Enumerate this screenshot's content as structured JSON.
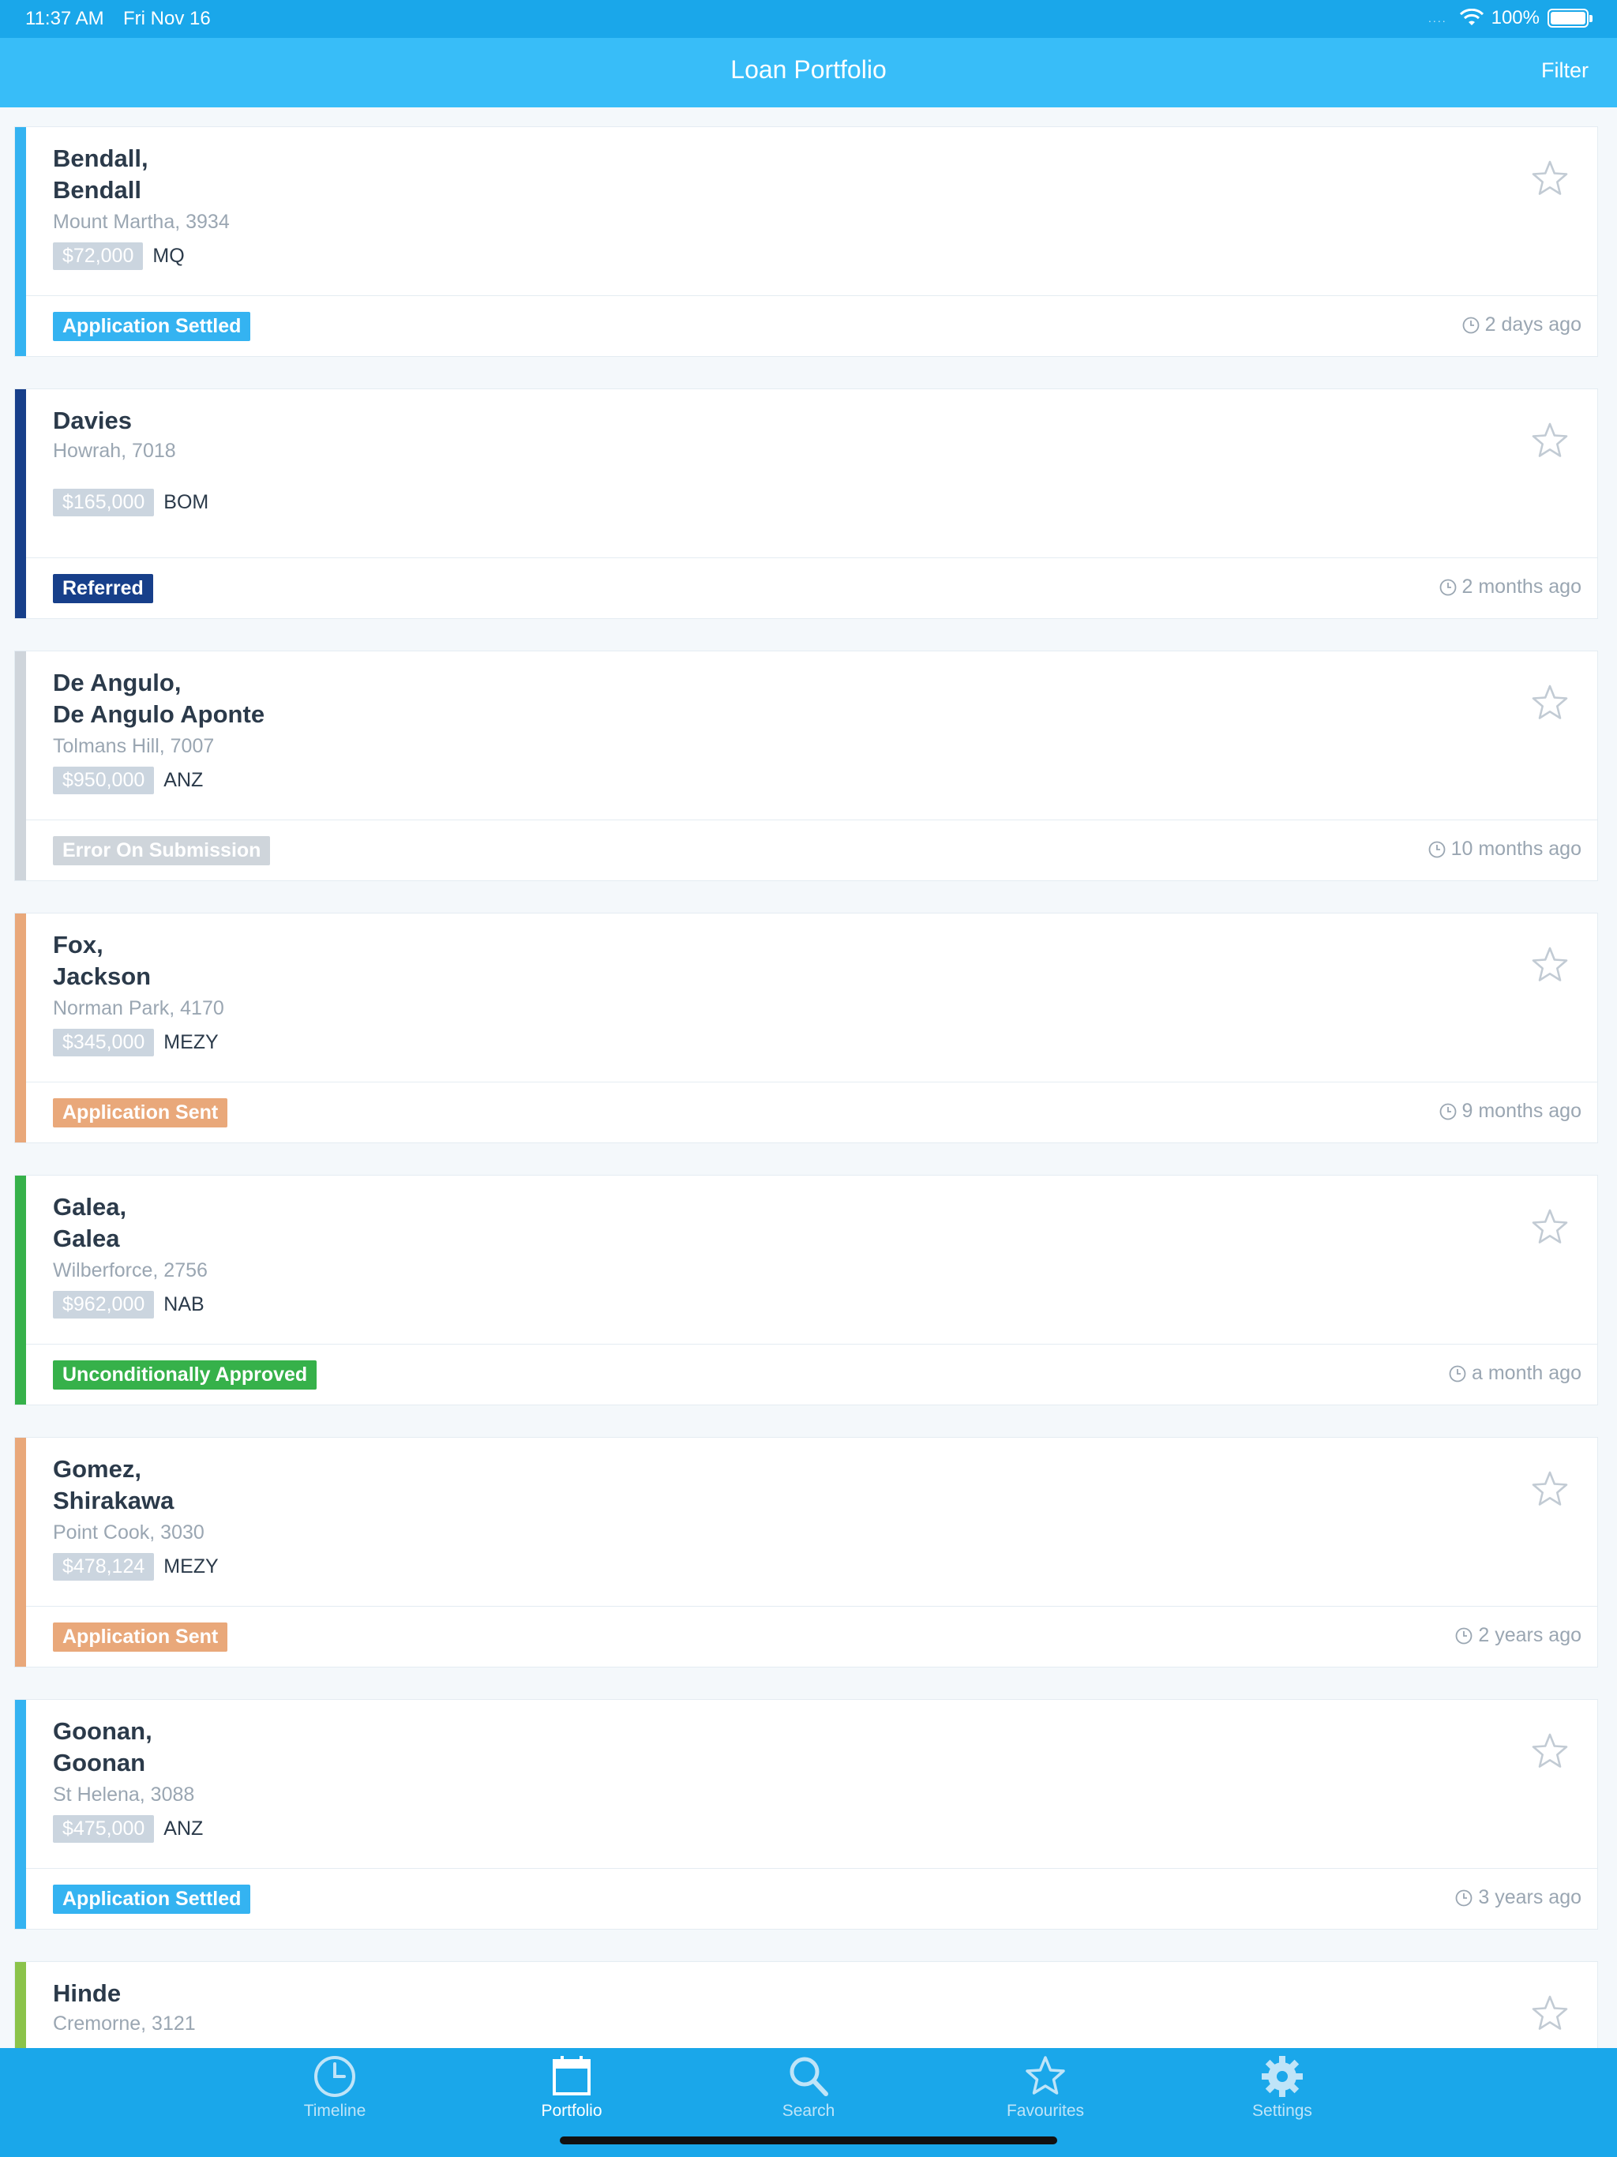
{
  "status_bar": {
    "time": "11:37 AM",
    "date": "Fri Nov 16",
    "signal": "....",
    "battery": "100%"
  },
  "header": {
    "title": "Loan Portfolio",
    "filter_label": "Filter"
  },
  "colors": {
    "settled": "#34b3f1",
    "referred": "#173f8a",
    "error": "#cfd5db",
    "sent": "#e9a87a",
    "approved": "#36b14a",
    "lime": "#8bc34a"
  },
  "loans": [
    {
      "name": "Bendall,\nBendall",
      "location": "Mount Martha, 3934",
      "amount": "$72,000",
      "lender": "MQ",
      "status": "Application Settled",
      "status_color": "#34b3f1",
      "ago": "2 days ago"
    },
    {
      "name": "Davies",
      "location": "Howrah, 7018",
      "amount": "$165,000",
      "lender": "BOM",
      "status": "Referred",
      "status_color": "#173f8a",
      "ago": "2 months ago"
    },
    {
      "name": "De Angulo,\nDe Angulo Aponte",
      "location": "Tolmans Hill, 7007",
      "amount": "$950,000",
      "lender": "ANZ",
      "status": "Error On Submission",
      "status_color": "#cfd5db",
      "ago": "10 months ago"
    },
    {
      "name": "Fox,\nJackson",
      "location": "Norman Park, 4170",
      "amount": "$345,000",
      "lender": "MEZY",
      "status": "Application Sent",
      "status_color": "#e9a87a",
      "ago": "9 months ago"
    },
    {
      "name": "Galea,\nGalea",
      "location": "Wilberforce, 2756",
      "amount": "$962,000",
      "lender": "NAB",
      "status": "Unconditionally Approved",
      "status_color": "#36b14a",
      "ago": "a month ago"
    },
    {
      "name": "Gomez,\nShirakawa",
      "location": "Point Cook, 3030",
      "amount": "$478,124",
      "lender": "MEZY",
      "status": "Application Sent",
      "status_color": "#e9a87a",
      "ago": "2 years ago"
    },
    {
      "name": "Goonan,\nGoonan",
      "location": "St Helena, 3088",
      "amount": "$475,000",
      "lender": "ANZ",
      "status": "Application Settled",
      "status_color": "#34b3f1",
      "ago": "3 years ago"
    },
    {
      "name": "Hinde",
      "location": "Cremorne, 3121",
      "amount": "",
      "lender": "",
      "status": "",
      "status_color": "#8bc34a",
      "ago": ""
    }
  ],
  "tabs": [
    {
      "label": "Timeline",
      "icon": "clock-icon",
      "active": false
    },
    {
      "label": "Portfolio",
      "icon": "calendar-icon",
      "active": true
    },
    {
      "label": "Search",
      "icon": "search-icon",
      "active": false
    },
    {
      "label": "Favourites",
      "icon": "star-icon",
      "active": false
    },
    {
      "label": "Settings",
      "icon": "gear-icon",
      "active": false
    }
  ]
}
